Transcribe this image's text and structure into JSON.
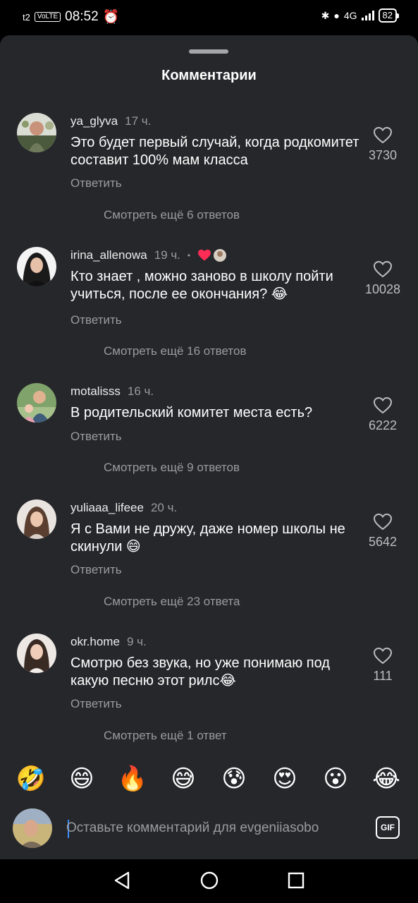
{
  "status_bar": {
    "carrier": "t2",
    "volte": "VoLTE",
    "time": "08:52",
    "network": "4G",
    "battery": "82"
  },
  "sheet": {
    "title": "Комментарии"
  },
  "comments": [
    {
      "username": "ya_glyva",
      "time": "17 ч.",
      "text": "Это будет первый случай, когда родкомитет составит 100% мам класса",
      "reply": "Ответить",
      "likes": "3730",
      "more": "Смотреть ещё 6 ответов"
    },
    {
      "username": "irina_allenowa",
      "time": "19 ч.",
      "text": "Кто знает , можно заново в школу пойти учиться, после ее окончания? 😂",
      "reply": "Ответить",
      "likes": "10028",
      "more": "Смотреть ещё 16 ответов"
    },
    {
      "username": "motalisss",
      "time": "16 ч.",
      "text": "В родительский комитет места есть?",
      "reply": "Ответить",
      "likes": "6222",
      "more": "Смотреть ещё 9 ответов"
    },
    {
      "username": "yuliaaa_lifeee",
      "time": "20 ч.",
      "text": "Я с Вами не дружу, даже номер школы не скинули 😄",
      "reply": "Ответить",
      "likes": "5642",
      "more": "Смотреть ещё 23 ответа"
    },
    {
      "username": "okr.home",
      "time": "9 ч.",
      "text": "Смотрю без звука, но уже понимаю под какую песню этот рилс😂",
      "reply": "Ответить",
      "likes": "111",
      "more": "Смотреть ещё 1 ответ"
    }
  ],
  "emoji_bar": [
    "🤣",
    "😄",
    "🔥",
    "😅",
    "😰",
    "😍",
    "😮",
    "😂"
  ],
  "input": {
    "placeholder": "Оставьте комментарий для evgeniiasobo",
    "gif_label": "GIF"
  },
  "colors": {
    "sheet_bg": "#26272b",
    "like_heart": "#ff2d55",
    "caret": "#3a8dff"
  }
}
